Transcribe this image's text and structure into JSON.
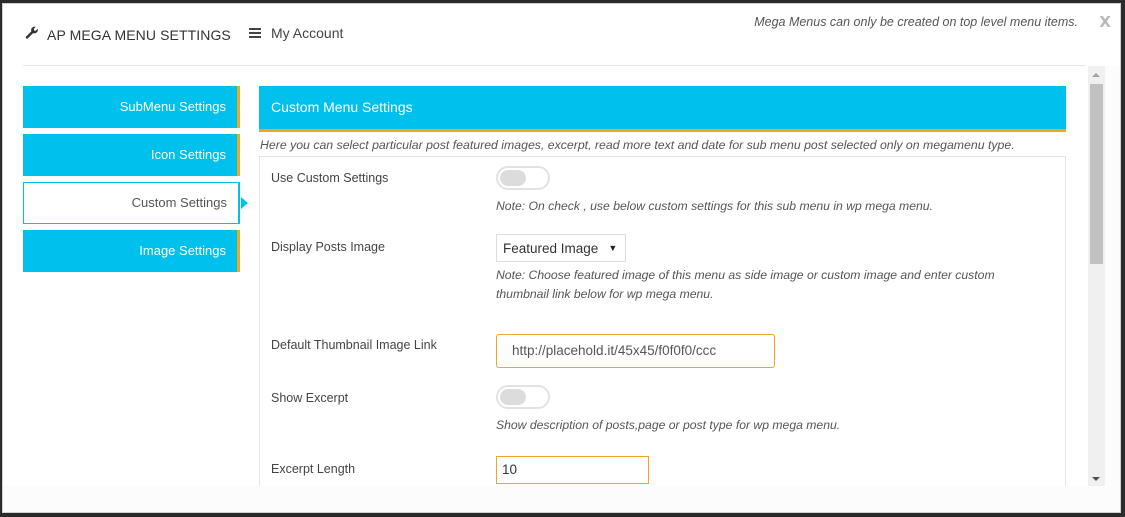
{
  "header": {
    "brand_icon": "wrench-icon",
    "brand_title": "AP MEGA MENU SETTINGS",
    "account_icon": "hamburger-icon",
    "account_label": "My Account",
    "notice": "Mega Menus can only be created on top level menu items.",
    "close_label": "X"
  },
  "sidebar": {
    "items": [
      {
        "label": "SubMenu Settings",
        "active": false
      },
      {
        "label": "Icon Settings",
        "active": false
      },
      {
        "label": "Custom Settings",
        "active": true
      },
      {
        "label": "Image Settings",
        "active": false
      }
    ]
  },
  "panel": {
    "title": "Custom Menu Settings",
    "description": "Here you can select particular post featured images, excerpt, read more text and date for sub menu post selected only on megamenu type.",
    "fields": {
      "use_custom": {
        "label": "Use Custom Settings",
        "checked": false,
        "note": "Note: On check , use below custom settings for this sub menu in wp mega menu."
      },
      "display_image": {
        "label": "Display Posts Image",
        "selected": "Featured Image",
        "note": "Note: Choose featured image of this menu as side image or custom image and enter custom thumbnail link below for wp mega menu."
      },
      "thumbnail_link": {
        "label": "Default Thumbnail Image Link",
        "value": "http://placehold.it/45x45/f0f0f0/ccc"
      },
      "show_excerpt": {
        "label": "Show Excerpt",
        "checked": false,
        "note": "Show description of posts,page or post type for wp mega menu."
      },
      "excerpt_length": {
        "label": "Excerpt Length",
        "value": "10"
      }
    }
  },
  "colors": {
    "accent": "#00c0ee",
    "accent_border": "#f4a623"
  }
}
